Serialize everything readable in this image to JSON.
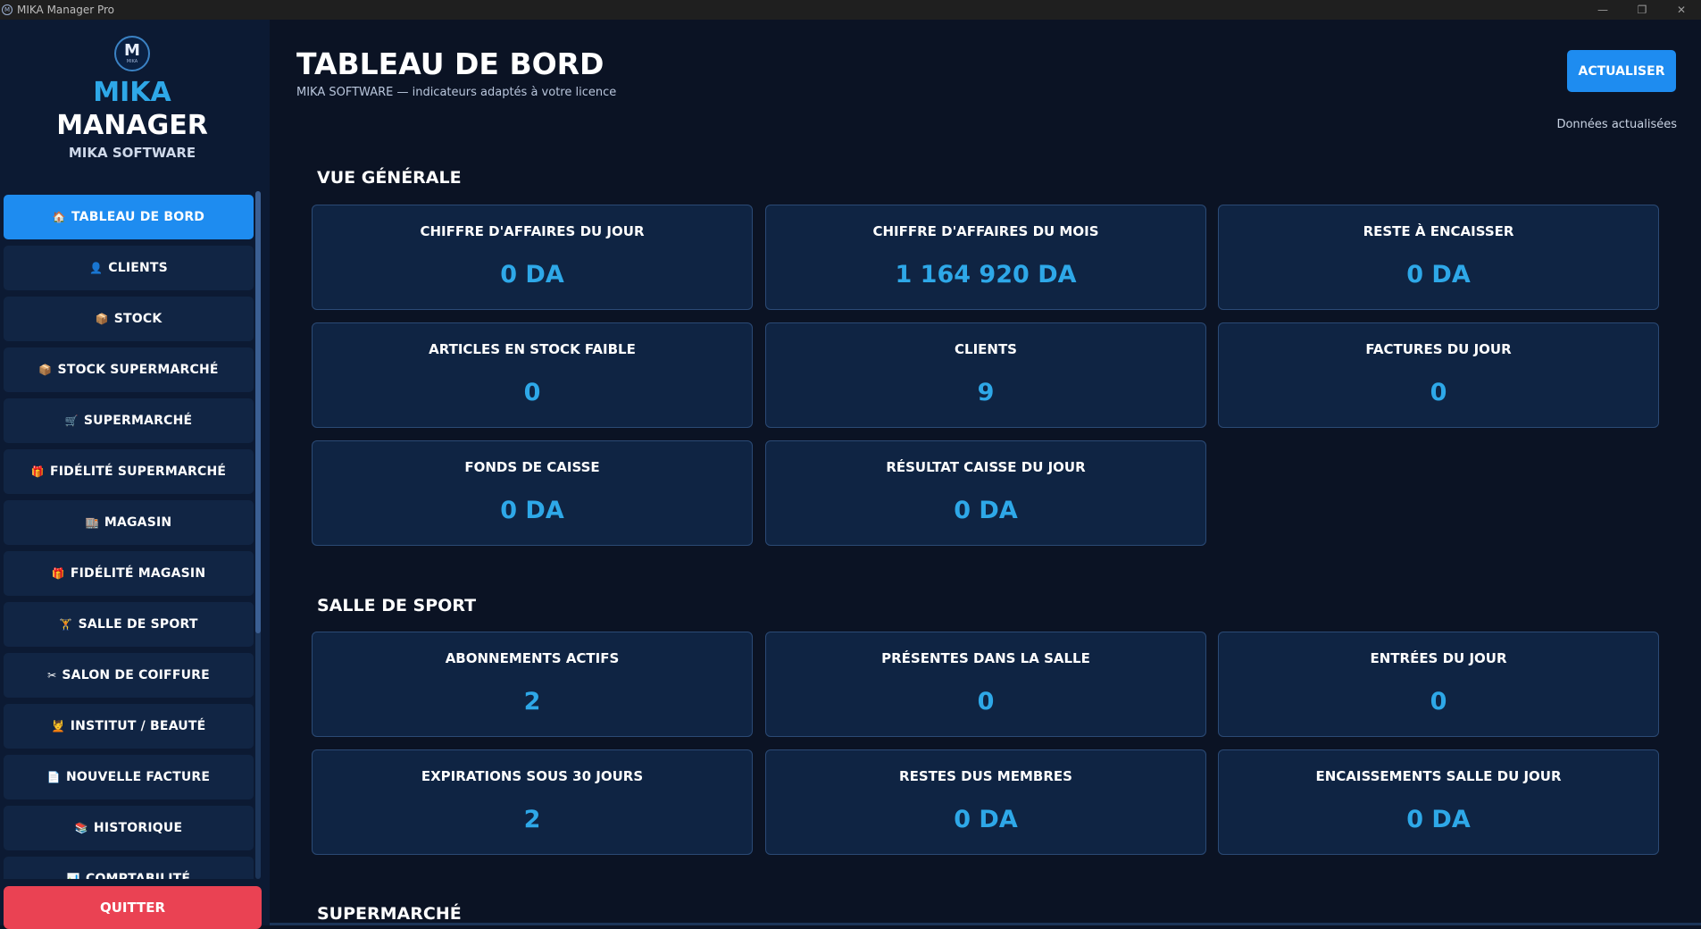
{
  "window": {
    "title": "MIKA Manager Pro",
    "minimize": "—",
    "restore": "❐",
    "close": "✕"
  },
  "brand": {
    "logo_letter": "M",
    "logo_small": "MIKA",
    "name_line1": "MIKA",
    "name_line2": "MANAGER",
    "subtitle": "MIKA SOFTWARE"
  },
  "sidebar": {
    "items": [
      {
        "icon": "🏠",
        "label": "TABLEAU DE BORD",
        "active": true
      },
      {
        "icon": "👤",
        "label": "CLIENTS"
      },
      {
        "icon": "📦",
        "label": "STOCK"
      },
      {
        "icon": "📦",
        "label": "STOCK SUPERMARCHÉ"
      },
      {
        "icon": "🛒",
        "label": "SUPERMARCHÉ"
      },
      {
        "icon": "🎁",
        "label": "FIDÉLITÉ SUPERMARCHÉ"
      },
      {
        "icon": "🏬",
        "label": "MAGASIN"
      },
      {
        "icon": "🎁",
        "label": "FIDÉLITÉ MAGASIN"
      },
      {
        "icon": "🏋",
        "label": "SALLE DE SPORT"
      },
      {
        "icon": "✂",
        "label": "SALON DE COIFFURE"
      },
      {
        "icon": "💆",
        "label": "INSTITUT / BEAUTÉ"
      },
      {
        "icon": "📄",
        "label": "NOUVELLE FACTURE"
      },
      {
        "icon": "📚",
        "label": "HISTORIQUE"
      },
      {
        "icon": "📊",
        "label": "COMPTABILITÉ"
      }
    ],
    "quit_label": "QUITTER"
  },
  "header": {
    "title": "TABLEAU DE BORD",
    "subtitle": "MIKA SOFTWARE — indicateurs adaptés à votre licence",
    "refresh_label": "ACTUALISER",
    "status": "Données actualisées"
  },
  "sections": {
    "general": {
      "title": "VUE GÉNÉRALE",
      "cards": [
        {
          "label": "CHIFFRE D'AFFAIRES DU JOUR",
          "value": "0 DA"
        },
        {
          "label": "CHIFFRE D'AFFAIRES DU MOIS",
          "value": "1 164 920 DA"
        },
        {
          "label": "RESTE À ENCAISSER",
          "value": "0 DA"
        },
        {
          "label": "ARTICLES EN STOCK FAIBLE",
          "value": "0"
        },
        {
          "label": "CLIENTS",
          "value": "9"
        },
        {
          "label": "FACTURES DU JOUR",
          "value": "0"
        },
        {
          "label": "FONDS DE CAISSE",
          "value": "0 DA"
        },
        {
          "label": "RÉSULTAT CAISSE DU JOUR",
          "value": "0 DA"
        }
      ]
    },
    "sport": {
      "title": "SALLE DE SPORT",
      "cards": [
        {
          "label": "ABONNEMENTS ACTIFS",
          "value": "2"
        },
        {
          "label": "PRÉSENTES DANS LA SALLE",
          "value": "0"
        },
        {
          "label": "ENTRÉES DU JOUR",
          "value": "0"
        },
        {
          "label": "EXPIRATIONS SOUS 30 JOURS",
          "value": "2"
        },
        {
          "label": "RESTES DUS MEMBRES",
          "value": "0 DA"
        },
        {
          "label": "ENCAISSEMENTS SALLE DU JOUR",
          "value": "0 DA"
        }
      ]
    },
    "supermarche": {
      "title": "SUPERMARCHÉ"
    }
  },
  "colors": {
    "accent": "#1e8cf0",
    "value": "#2ea8e8",
    "danger": "#ea4253",
    "card_bg": "#0f2443",
    "sidebar_bg": "#0c1a33"
  }
}
